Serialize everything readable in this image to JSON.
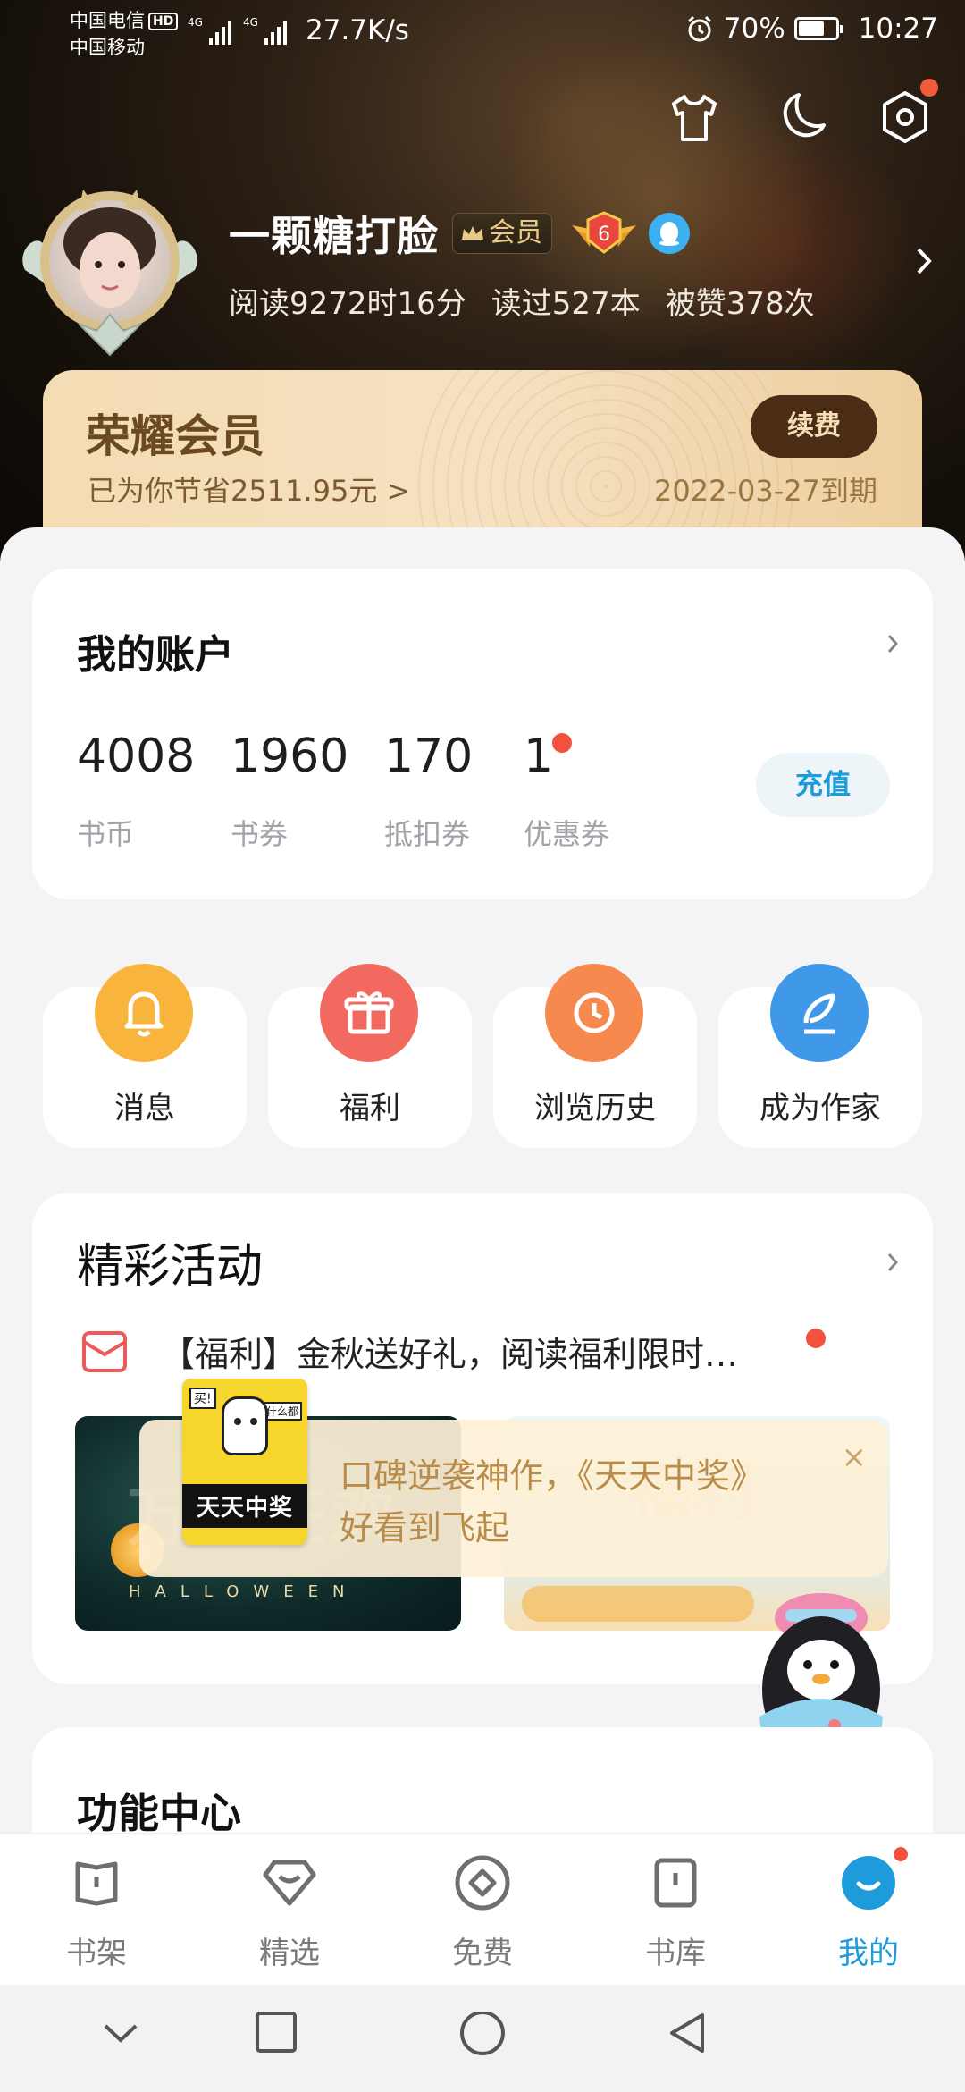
{
  "status_bar": {
    "carrier1": "中国电信",
    "hd": "HD",
    "carrier2": "中国移动",
    "net1": "4G",
    "net2": "4G",
    "speed": "27.7K/s",
    "battery": "70%",
    "battery_level": 0.7,
    "time": "10:27"
  },
  "header_icons": [
    "shirt-icon",
    "moon-icon",
    "settings-icon"
  ],
  "profile": {
    "username": "一颗糖打脸",
    "vip_tag": "会员",
    "level": "6",
    "stats": {
      "read_time": "阅读9272时16分",
      "books_read": "读过527本",
      "likes": "被赞378次"
    }
  },
  "vip_card": {
    "title": "荣耀会员",
    "savings": "已为你节省2511.95元 >",
    "renew_label": "续费",
    "expiry": "2022-03-27到期"
  },
  "account": {
    "title": "我的账户",
    "items": [
      {
        "value": "4008",
        "label": "书币"
      },
      {
        "value": "1960",
        "label": "书券"
      },
      {
        "value": "170",
        "label": "抵扣券"
      },
      {
        "value": "1",
        "label": "优惠券"
      }
    ],
    "recharge_label": "充值"
  },
  "shortcuts": [
    {
      "label": "消息",
      "icon": "bell-icon",
      "color": "#f8b43c"
    },
    {
      "label": "福利",
      "icon": "gift-icon",
      "color": "#f26a5f"
    },
    {
      "label": "浏览历史",
      "icon": "clock-icon",
      "color": "#f6894e"
    },
    {
      "label": "成为作家",
      "icon": "pen-icon",
      "color": "#3f98e8"
    }
  ],
  "events": {
    "title": "精彩活动",
    "item_text": "【福利】金秋送好礼，阅读福利限时…",
    "banner1_text": "HALLOWEEN"
  },
  "popup": {
    "book_title": "天天中奖",
    "tag1": "买!",
    "tag2": "什么都",
    "line1": "口碑逆袭神作，《天天中奖》",
    "line2": "好看到飞起",
    "close": "×"
  },
  "features": {
    "title": "功能中心"
  },
  "tabs": [
    {
      "label": "书架",
      "icon": "bookshelf-icon"
    },
    {
      "label": "精选",
      "icon": "featured-icon"
    },
    {
      "label": "免费",
      "icon": "free-icon"
    },
    {
      "label": "书库",
      "icon": "library-icon"
    },
    {
      "label": "我的",
      "icon": "me-icon",
      "active": true
    }
  ],
  "colors": {
    "accent": "#1d9bdb",
    "badge_red": "#f2513d",
    "vip_brown": "#4b2d15"
  }
}
